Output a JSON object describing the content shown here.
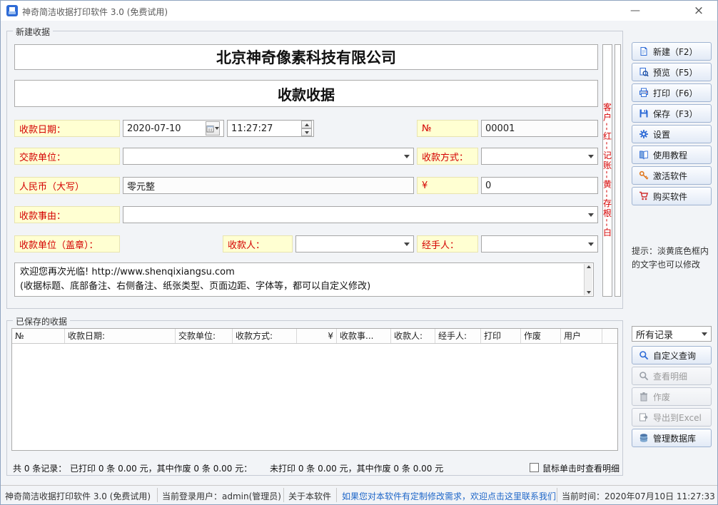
{
  "window": {
    "title": "神奇简洁收据打印软件 3.0 (免费试用)",
    "minimize_glyph": "—",
    "close_glyph": "×"
  },
  "form": {
    "group_label": "新建收据",
    "company_name": "北京神奇像素科技有限公司",
    "receipt_title": "收款收据",
    "date_label": "收款日期：",
    "date_value": "2020-07-10",
    "time_value": "11:27:27",
    "no_label": "№",
    "no_value": "00001",
    "payer_label": "交款单位：",
    "payer_value": "",
    "method_label": "收款方式：",
    "method_value": "",
    "rmb_label": "人民币（大写）",
    "rmb_value": "零元整",
    "yen_label": "¥",
    "amount_value": "0",
    "reason_label": "收款事由：",
    "reason_value": "",
    "stamp_label": "收款单位（盖章）：",
    "payee_label": "收款人：",
    "payee_value": "",
    "handler_label": "经手人：",
    "handler_value": "",
    "note_line1": "欢迎您再次光临! http://www.shenqixiangsu.com",
    "note_line2": "(收据标题、底部备注、右侧备注、纸张类型、页面边距、字体等，都可以自定义修改)",
    "copy_strip": "客户--红--记账--黄--存根--白"
  },
  "sidebar": {
    "buttons": [
      {
        "label": "新建（F2）",
        "icon": "new-icon"
      },
      {
        "label": "预览（F5）",
        "icon": "preview-icon"
      },
      {
        "label": "打印（F6）",
        "icon": "print-icon"
      },
      {
        "label": "保存（F3）",
        "icon": "save-icon"
      },
      {
        "label": "设置",
        "icon": "settings-icon"
      },
      {
        "label": "使用教程",
        "icon": "tutorial-icon"
      },
      {
        "label": "激活软件",
        "icon": "activate-icon"
      },
      {
        "label": "购买软件",
        "icon": "buy-icon"
      }
    ],
    "tip": "提示：淡黄底色框内的文字也可以修改"
  },
  "records": {
    "group_label": "已保存的收据",
    "columns": [
      "№",
      "收款日期:",
      "交款单位:",
      "收款方式:",
      "¥",
      "收款事...",
      "收款人:",
      "经手人:",
      "打印",
      "作废",
      "用户"
    ],
    "rows": [],
    "filter_value": "所有记录",
    "actions": [
      {
        "label": "自定义查询",
        "icon": "query-icon",
        "enabled": true
      },
      {
        "label": "查看明细",
        "icon": "detail-icon",
        "enabled": false
      },
      {
        "label": "作废",
        "icon": "void-icon",
        "enabled": false
      },
      {
        "label": "导出到Excel",
        "icon": "export-icon",
        "enabled": false
      },
      {
        "label": "管理数据库",
        "icon": "database-icon",
        "enabled": true
      }
    ],
    "summary_total": "共 0 条记录：",
    "summary_printed": "已打印 0 条 0.00 元，其中作废 0 条 0.00 元：",
    "summary_unprinted": "未打印 0 条 0.00 元，其中作废 0 条 0.00 元",
    "checkbox_label": "鼠标单击时查看明细",
    "checkbox_checked": false
  },
  "statusbar": {
    "app": "神奇简洁收据打印软件 3.0 (免费试用)",
    "user": "当前登录用户：admin(管理员)",
    "about": "关于本软件",
    "contact": "如果您对本软件有定制修改需求，欢迎点击这里联系我们",
    "time": "当前时间：2020年07月10日 11:27:33"
  },
  "colors": {
    "label_bg": "#FFFFD2",
    "label_text": "#D40000",
    "link": "#1E66C8",
    "accent": "#2E6BD6"
  }
}
